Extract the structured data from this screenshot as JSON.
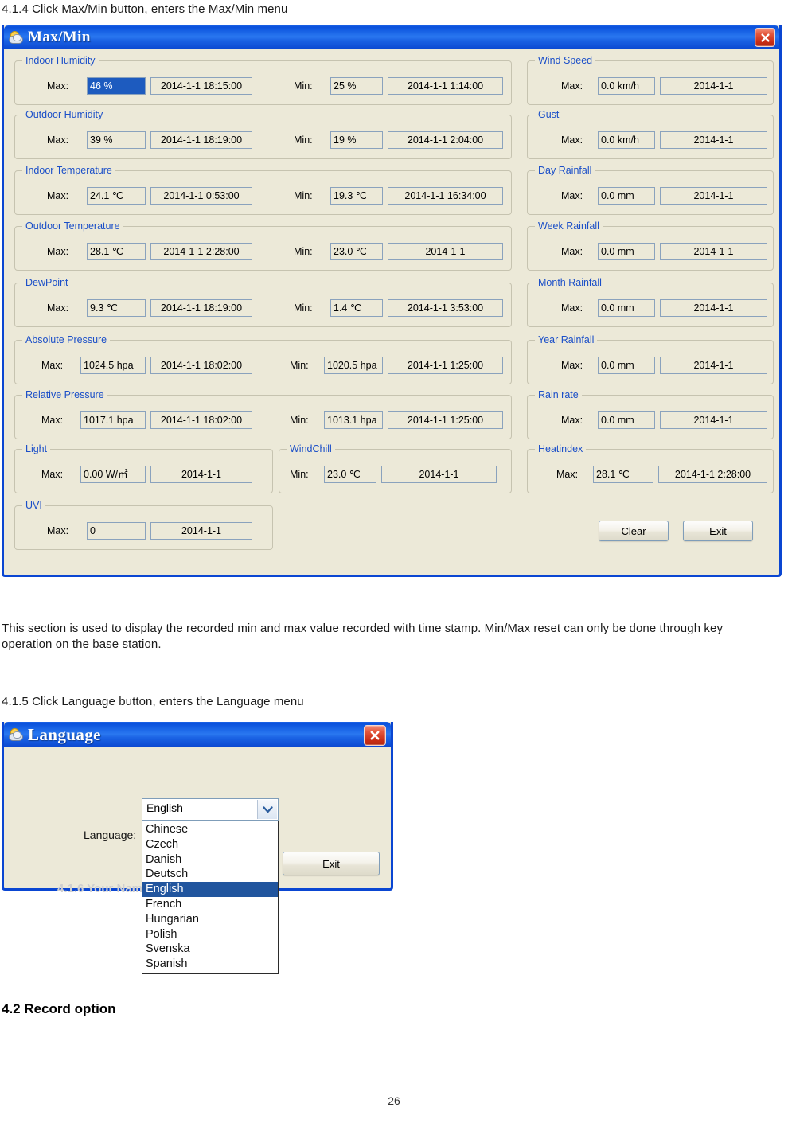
{
  "document": {
    "heading_414": "4.1.4 Click Max/Min button, enters the Max/Min menu",
    "paragraph_1": "This section is used to display the recorded min and max value recorded with time stamp. Min/Max reset can only be done through key operation on the base station.",
    "heading_415": "4.1.5 Click Language button, enters the Language menu",
    "heading_42": "4.2 Record option",
    "page_number": "26"
  },
  "maxmin_window": {
    "title": "Max/Min",
    "close_tooltip": "Close",
    "max_label": "Max:",
    "min_label": "Min:",
    "buttons": {
      "clear": "Clear",
      "exit": "Exit"
    },
    "left_groups": [
      {
        "legend": "Indoor Humidity",
        "max_value": "46 %",
        "max_value_selected": true,
        "max_time": "2014-1-1 18:15:00",
        "min_value": "25 %",
        "min_time": "2014-1-1 1:14:00"
      },
      {
        "legend": "Outdoor Humidity",
        "max_value": "39 %",
        "max_value_selected": false,
        "max_time": "2014-1-1 18:19:00",
        "min_value": "19 %",
        "min_time": "2014-1-1 2:04:00"
      },
      {
        "legend": "Indoor Temperature",
        "max_value": "24.1 ℃",
        "max_value_selected": false,
        "max_time": "2014-1-1 0:53:00",
        "min_value": "19.3 ℃",
        "min_time": "2014-1-1 16:34:00"
      },
      {
        "legend": "Outdoor Temperature",
        "max_value": "28.1 ℃",
        "max_value_selected": false,
        "max_time": "2014-1-1 2:28:00",
        "min_value": "23.0 ℃",
        "min_time": "2014-1-1"
      },
      {
        "legend": "DewPoint",
        "max_value": "9.3 ℃",
        "max_value_selected": false,
        "max_time": "2014-1-1 18:19:00",
        "min_value": "1.4 ℃",
        "min_time": "2014-1-1 3:53:00"
      },
      {
        "legend": "Absolute Pressure",
        "max_value": "1024.5 hpa",
        "max_value_selected": false,
        "max_time": "2014-1-1 18:02:00",
        "min_value": "1020.5 hpa",
        "min_time": "2014-1-1 1:25:00"
      },
      {
        "legend": "Relative Pressure",
        "max_value": "1017.1 hpa",
        "max_value_selected": false,
        "max_time": "2014-1-1 18:02:00",
        "min_value": "1013.1 hpa",
        "min_time": "2014-1-1 1:25:00"
      }
    ],
    "light_group": {
      "legend": "Light",
      "max_label": "Max:",
      "max_value": "0.00 W/㎡",
      "max_time": "2014-1-1"
    },
    "windchill_group": {
      "legend": "WindChill",
      "min_label": "Min:",
      "min_value": "23.0 ℃",
      "min_time": "2014-1-1"
    },
    "uvi_group": {
      "legend": "UVI",
      "max_label": "Max:",
      "max_value": "0",
      "max_time": "2014-1-1"
    },
    "right_groups": [
      {
        "legend": "Wind Speed",
        "max_value": "0.0 km/h",
        "max_time": "2014-1-1"
      },
      {
        "legend": "Gust",
        "max_value": "0.0 km/h",
        "max_time": "2014-1-1"
      },
      {
        "legend": "Day Rainfall",
        "max_value": "0.0 mm",
        "max_time": "2014-1-1"
      },
      {
        "legend": "Week Rainfall",
        "max_value": "0.0 mm",
        "max_time": "2014-1-1"
      },
      {
        "legend": "Month Rainfall",
        "max_value": "0.0 mm",
        "max_time": "2014-1-1"
      },
      {
        "legend": "Year Rainfall",
        "max_value": "0.0 mm",
        "max_time": "2014-1-1"
      },
      {
        "legend": "Rain rate",
        "max_value": "0.0 mm",
        "max_time": "2014-1-1"
      },
      {
        "legend": "Heatindex",
        "max_value": "28.1 ℃",
        "max_time": "2014-1-1 2:28:00"
      }
    ]
  },
  "language_window": {
    "title": "Language",
    "label": "Language:",
    "selected": "English",
    "options": [
      "Chinese",
      "Czech",
      "Danish",
      "Deutsch",
      "English",
      "French",
      "Hungarian",
      "Polish",
      "Svenska",
      "Spanish"
    ],
    "exit_button": "Exit"
  },
  "colors": {
    "dialog_face": "#ECE9D8",
    "titlebar_blue": "#0A46D2",
    "legend_text": "#1B4FC8",
    "selection_blue": "#1D5BBF",
    "close_red": "#C92D16"
  }
}
